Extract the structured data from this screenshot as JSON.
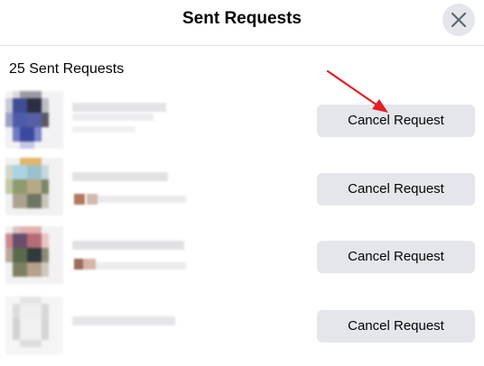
{
  "dialog": {
    "title": "Sent Requests",
    "close_icon": "close-icon"
  },
  "summary": {
    "count_label": "25 Sent Requests"
  },
  "requests": [
    {
      "button_label": "Cancel Request"
    },
    {
      "button_label": "Cancel Request"
    },
    {
      "button_label": "Cancel Request"
    },
    {
      "button_label": "Cancel Request"
    }
  ],
  "annotation": {
    "arrow_color": "#e41e26"
  }
}
